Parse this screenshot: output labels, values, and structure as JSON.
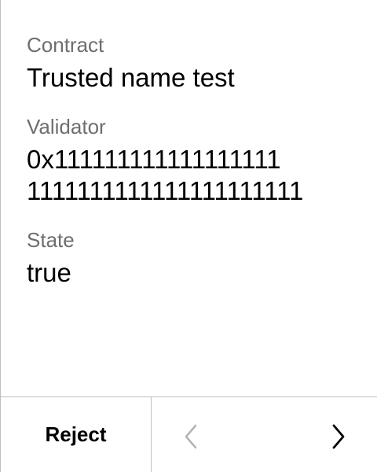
{
  "review": {
    "fields": [
      {
        "label": "Contract",
        "value": "Trusted name test"
      },
      {
        "label": "Validator",
        "value": "0x1111111111111111111111111111111111111111"
      },
      {
        "label": "State",
        "value": "true"
      }
    ]
  },
  "footer": {
    "reject_label": "Reject",
    "prev_icon": "chevron-left-icon",
    "next_icon": "chevron-right-icon",
    "prev_state": "disabled"
  },
  "colors": {
    "label": "#6e6e6e",
    "value": "#000000",
    "divider": "#bfbfbf",
    "disabled_icon": "#b3b3b3"
  }
}
